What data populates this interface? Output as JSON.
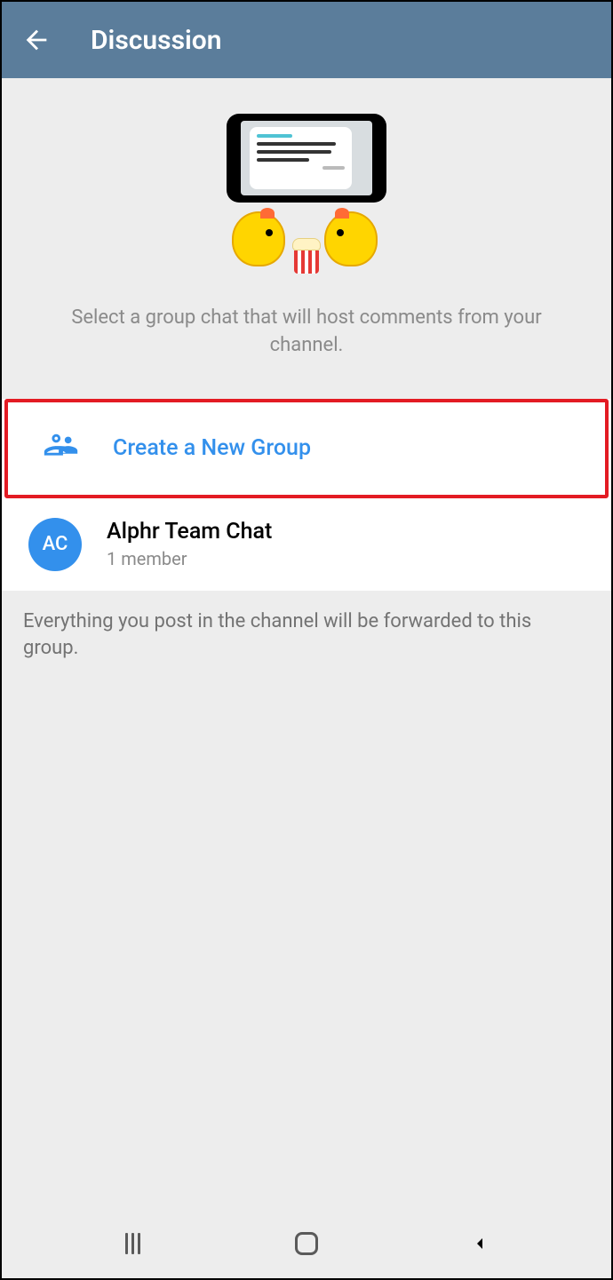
{
  "header": {
    "title": "Discussion"
  },
  "intro": {
    "description": "Select a group chat that will host comments from your channel."
  },
  "actions": {
    "createGroup": {
      "label": "Create a New Group"
    }
  },
  "groups": [
    {
      "initials": "AC",
      "name": "Alphr Team Chat",
      "members": "1 member"
    }
  ],
  "footer": {
    "note": "Everything you post in the channel will be forwarded to this group."
  }
}
